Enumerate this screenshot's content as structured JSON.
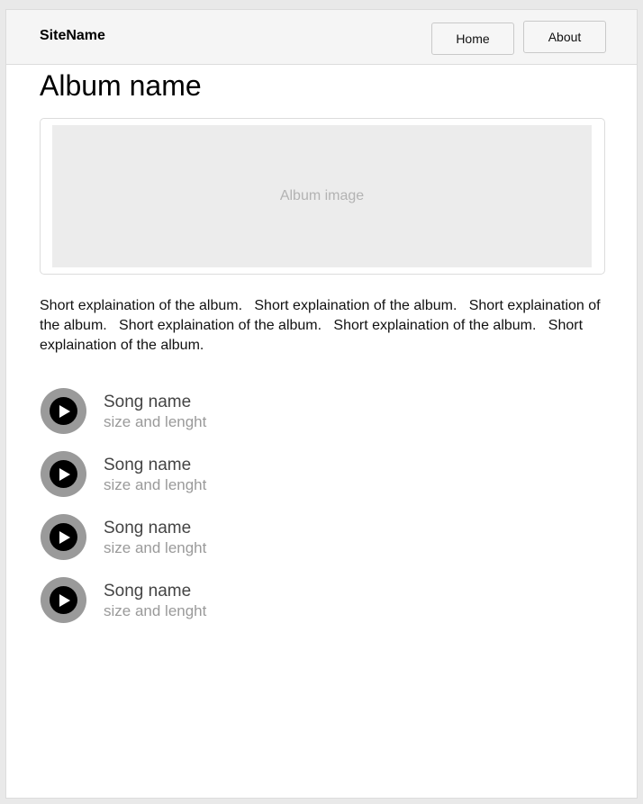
{
  "navbar": {
    "brand": "SiteName",
    "links": [
      {
        "label": "Home"
      },
      {
        "label": "About"
      }
    ]
  },
  "album": {
    "title": "Album name",
    "image_placeholder": "Album image",
    "description": "Short explaination of the album.   Short explaination of the album.   Short explaination of the album.   Short explaination of the album.   Short explaination of the album.   Short explaination of the album."
  },
  "songs": [
    {
      "name": "Song name",
      "meta": "size and lenght",
      "icon": "play-icon"
    },
    {
      "name": "Song name",
      "meta": "size and lenght",
      "icon": "play-icon"
    },
    {
      "name": "Song name",
      "meta": "size and lenght",
      "icon": "play-icon"
    },
    {
      "name": "Song name",
      "meta": "size and lenght",
      "icon": "play-icon"
    }
  ],
  "colors": {
    "navbar_bg": "#f5f5f5",
    "placeholder_bg": "#ececec",
    "play_button_ring": "#9a9a9a",
    "play_button_core": "#000000"
  }
}
